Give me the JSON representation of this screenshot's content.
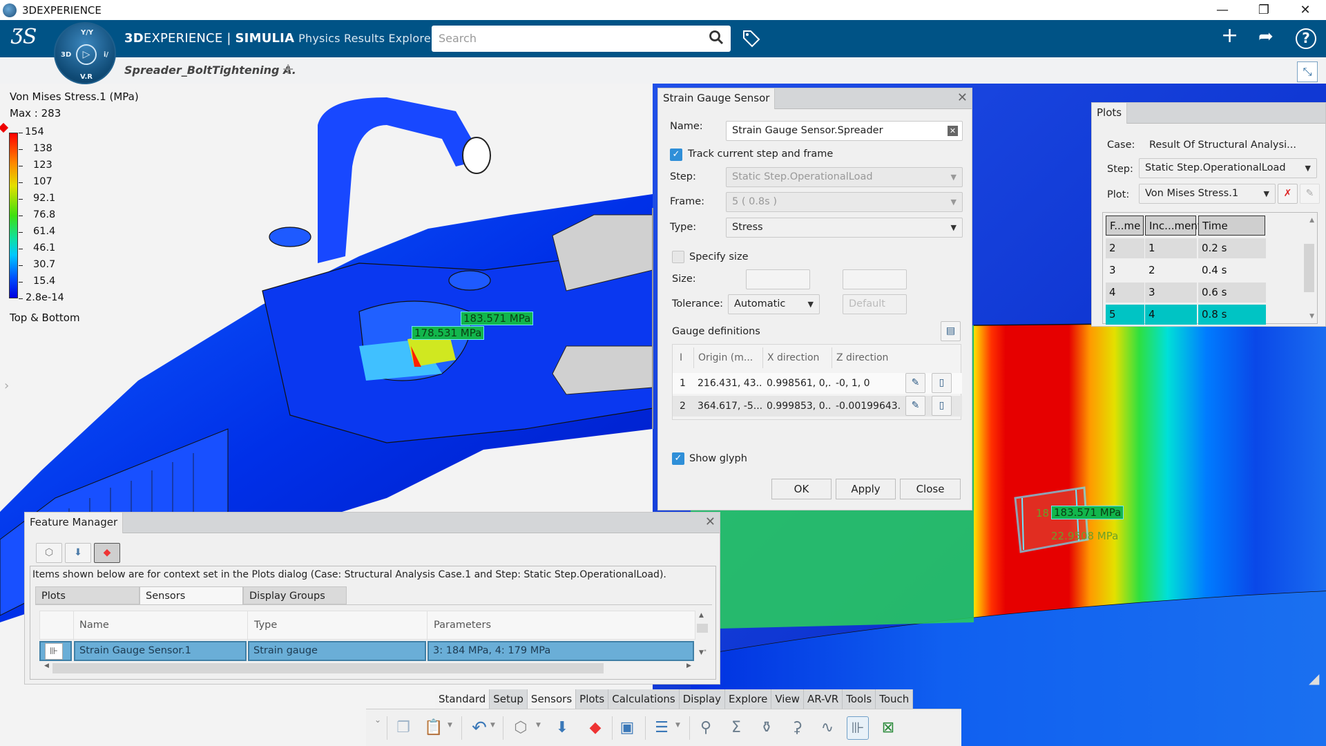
{
  "window": {
    "title": "3DEXPERIENCE",
    "controls": {
      "minimize": "—",
      "restore": "❐",
      "close": "✕"
    }
  },
  "appbar": {
    "brand_bold": "3D",
    "brand_rest": "EXPERIENCE",
    "separator": " | ",
    "product": "SIMULIA",
    "app_name": "Physics Results Explorer",
    "search_placeholder": "Search",
    "compass": {
      "top": "Y/Y",
      "left": "3D",
      "right": "i/",
      "bottom": "V.R"
    },
    "icons": {
      "add": "+",
      "share": "➦",
      "help": "?",
      "tag": "🏷",
      "search": "🔍"
    }
  },
  "document_tab": {
    "label": "Spreader_BoltTightening A.",
    "add": "+"
  },
  "legend": {
    "title": "Von Mises Stress.1 (MPa)",
    "max": "Max : 283",
    "ticks": [
      "154",
      "138",
      "123",
      "107",
      "92.1",
      "76.8",
      "61.4",
      "46.1",
      "30.7",
      "15.4",
      "2.8e-14"
    ],
    "footer": "Top & Bottom"
  },
  "viewport_labels": {
    "gauge1": "183.571 MPa",
    "gauge2": "178.531 MPa",
    "gauge_zoom": "183.571 MPa",
    "faded_partial": "18",
    "faded_second": "22.9508 MPa"
  },
  "strain_gauge_dialog": {
    "title": "Strain Gauge Sensor",
    "name_label": "Name:",
    "name_value": "Strain Gauge Sensor.Spreader",
    "track_label": "Track current step and frame",
    "track_checked": true,
    "step_label": "Step:",
    "step_value": "Static Step.OperationalLoad",
    "frame_label": "Frame:",
    "frame_value": "5 ( 0.8s )",
    "type_label": "Type:",
    "type_value": "Stress",
    "specify_size_label": "Specify size",
    "specify_size_checked": false,
    "size_label": "Size:",
    "tolerance_label": "Tolerance:",
    "tolerance_value": "Automatic",
    "default_placeholder": "Default",
    "gauge_definitions_label": "Gauge definitions",
    "gauge_columns": [
      "I",
      "Origin (m...",
      "X direction",
      "Z direction"
    ],
    "gauge_rows": [
      {
        "i": "1",
        "origin": "216.431, 43....",
        "x": "0.998561, 0,...",
        "z": "-0, 1, 0"
      },
      {
        "i": "2",
        "origin": "364.617, -5....",
        "x": "0.999853, 0...",
        "z": "-0.00199643..."
      }
    ],
    "show_glyph_label": "Show glyph",
    "show_glyph_checked": true,
    "ok": "OK",
    "apply": "Apply",
    "close": "Close"
  },
  "plots_panel": {
    "title": "Plots",
    "case_label": "Case:",
    "case_value": "Result Of Structural Analysi...",
    "step_label": "Step:",
    "step_value": "Static Step.OperationalLoad",
    "plot_label": "Plot:",
    "plot_value": "Von Mises Stress.1",
    "columns": [
      "F...me",
      "Inc...ment",
      "Time"
    ],
    "rows": [
      {
        "frame": "2",
        "increment": "1",
        "time": "0.2 s",
        "selected": false
      },
      {
        "frame": "3",
        "increment": "2",
        "time": "0.4 s",
        "selected": false
      },
      {
        "frame": "4",
        "increment": "3",
        "time": "0.6 s",
        "selected": false
      },
      {
        "frame": "5",
        "increment": "4",
        "time": "0.8 s",
        "selected": true
      }
    ],
    "selected_color": "#00c4c4"
  },
  "feature_manager": {
    "title": "Feature Manager",
    "info": "Items shown below are for context set in the Plots dialog (Case: Structural Analysis Case.1 and Step: Static Step.OperationalLoad).",
    "tabs": [
      "Plots",
      "Sensors",
      "Display Groups"
    ],
    "active_tab": "Sensors",
    "columns": [
      "Name",
      "Type",
      "Parameters"
    ],
    "rows": [
      {
        "name": "Strain Gauge Sensor.1",
        "type": "Strain gauge",
        "parameters": "3: 184 MPa, 4: 179 MPa",
        "selected": true
      }
    ]
  },
  "ribbon": {
    "tabs": [
      "Standard",
      "Setup",
      "Sensors",
      "Plots",
      "Calculations",
      "Display",
      "Explore",
      "View",
      "AR-VR",
      "Tools",
      "Touch"
    ],
    "active_tab": "Sensors"
  },
  "colors": {
    "brand": "#005386",
    "selection": "#6aaed7",
    "checkbox": "#2f8fd8",
    "gauge_label": "#12b64c"
  }
}
